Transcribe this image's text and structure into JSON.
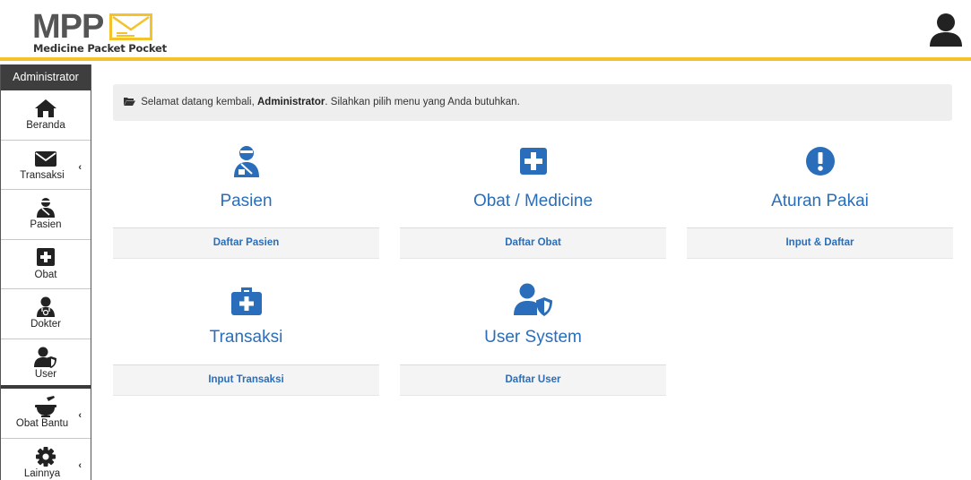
{
  "header": {
    "logo_text": "MPP",
    "logo_subtitle": "Medicine Packet Pocket",
    "user_icon": "user-icon"
  },
  "colors": {
    "accent": "#f4c22b",
    "primary_blue": "#2a6ebb",
    "sidebar_title_bg": "#3e3e3e"
  },
  "sidebar": {
    "title": "Administrator",
    "items": [
      {
        "label": "Beranda",
        "icon": "home-icon"
      },
      {
        "label": "Transaksi",
        "icon": "envelope-icon",
        "caret": "‹"
      },
      {
        "label": "Pasien",
        "icon": "patient-icon"
      },
      {
        "label": "Obat",
        "icon": "medical-plus-icon"
      },
      {
        "label": "Dokter",
        "icon": "doctor-icon"
      },
      {
        "label": "User",
        "icon": "user-shield-icon"
      },
      {
        "label": "Obat Bantu",
        "icon": "mortar-pestle-icon",
        "caret": "‹"
      },
      {
        "label": "Lainnya",
        "icon": "gear-icon",
        "caret": "‹"
      }
    ]
  },
  "welcome": {
    "prefix": "Selamat datang kembali,",
    "name": "Administrator",
    "suffix": ".  Silahkan pilih menu yang Anda butuhkan."
  },
  "tiles": [
    {
      "title": "Pasien",
      "button": "Daftar Pasien",
      "icon": "patient-icon"
    },
    {
      "title": "Obat / Medicine",
      "button": "Daftar Obat",
      "icon": "medical-plus-icon"
    },
    {
      "title": "Aturan Pakai",
      "button": "Input & Daftar",
      "icon": "exclamation-circle-icon"
    },
    {
      "title": "Transaksi",
      "button": "Input Transaksi",
      "icon": "medkit-icon"
    },
    {
      "title": "User System",
      "button": "Daftar User",
      "icon": "user-shield-icon"
    }
  ]
}
